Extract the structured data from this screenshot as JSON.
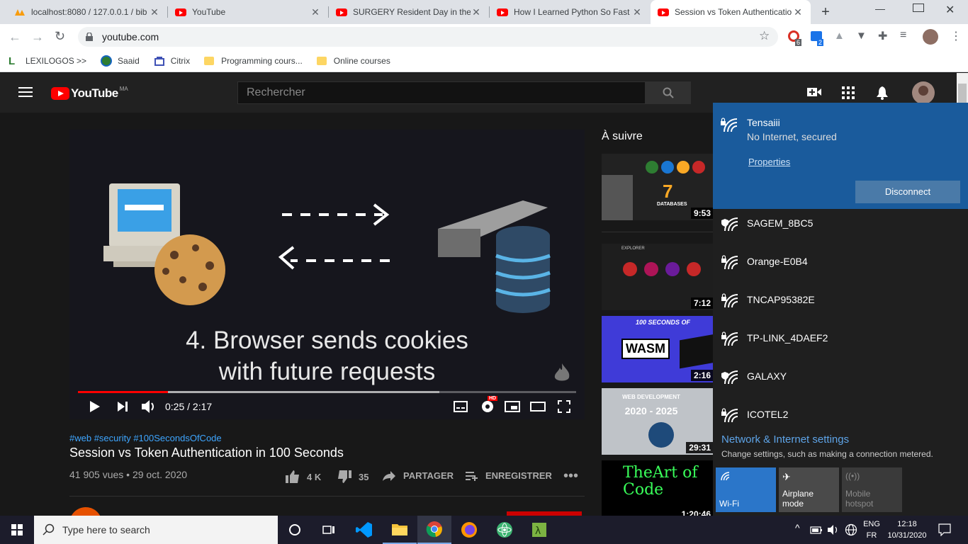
{
  "browser": {
    "tabs": [
      {
        "title": "localhost:8080 / 127.0.0.1 / bib",
        "icon": "phpmyadmin-icon"
      },
      {
        "title": "YouTube",
        "icon": "youtube-icon"
      },
      {
        "title": "SURGERY Resident Day in the L",
        "icon": "youtube-icon"
      },
      {
        "title": "How I Learned Python So Fast",
        "icon": "youtube-icon"
      },
      {
        "title": "Session vs Token Authenticatio",
        "icon": "youtube-icon"
      }
    ],
    "url": "youtube.com",
    "extension_badges": {
      "a": "6",
      "b": "2"
    },
    "bookmarks": [
      "LEXILOGOS >>",
      "Saaid",
      "Citrix",
      "Programming cours...",
      "Online courses"
    ]
  },
  "youtube": {
    "logo_text": "YouTube",
    "region": "MA",
    "search_placeholder": "Rechercher",
    "video": {
      "slide_caption_line1": "4. Browser sends cookies",
      "slide_caption_line2": "with future requests",
      "time": "0:25 / 2:17",
      "progress": 0.18,
      "hd_badge": "HD"
    },
    "hashtags": "#web #security #100SecondsOfCode",
    "title": "Session vs Token Authentication in 100 Seconds",
    "meta": "41 905 vues • 29 oct. 2020",
    "actions": {
      "likes": "4 K",
      "dislikes": "35",
      "share": "PARTAGER",
      "save": "ENREGISTRER"
    },
    "up_next_label": "À suivre",
    "up_next": [
      {
        "duration": "9:53",
        "thumb_text": "DATABASES",
        "big_number": "7"
      },
      {
        "duration": "7:12",
        "thumb_text": "EXPLORER"
      },
      {
        "duration": "2:16",
        "thumb_text": "WASM",
        "top_text": "100 SECONDS OF"
      },
      {
        "duration": "29:31",
        "top_text": "WEB DEVELOPMENT",
        "thumb_text": "2020 - 2025"
      },
      {
        "duration": "1:20:46",
        "thumb_text": "TheArt of Code"
      }
    ]
  },
  "wifi": {
    "connected": {
      "name": "Tensaiii",
      "status": "No Internet, secured",
      "properties": "Properties",
      "disconnect": "Disconnect"
    },
    "networks": [
      "SAGEM_8BC5",
      "Orange-E0B4",
      "TNCAP95382E",
      "TP-LINK_4DAEF2",
      "GALAXY",
      "ICOTEL2"
    ],
    "settings_title": "Network & Internet settings",
    "settings_desc": "Change settings, such as making a connection metered.",
    "quick_actions": [
      {
        "label": "Wi-Fi",
        "state": "on"
      },
      {
        "label": "Airplane mode",
        "state": "off"
      },
      {
        "label": "Mobile hotspot",
        "state": "disabled"
      }
    ]
  },
  "taskbar": {
    "search_placeholder": "Type here to search",
    "lang_top": "ENG",
    "lang_bottom": "FR",
    "time": "12:18",
    "date": "10/31/2020"
  },
  "colors": {
    "yt_red": "#ff0000",
    "flyout_accent": "#1a5b9c",
    "link_blue": "#3ea6ff"
  }
}
